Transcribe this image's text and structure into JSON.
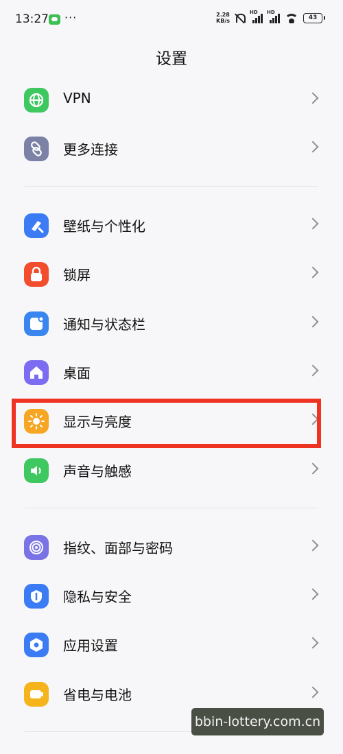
{
  "status_bar": {
    "time": "13:27",
    "net_speed_value": "2.28",
    "net_speed_unit": "KB/s",
    "sim_label": "HD",
    "battery": "43",
    "more": "···"
  },
  "page": {
    "title": "设置"
  },
  "groups": [
    [
      {
        "label": "VPN",
        "icon": "globe-icon",
        "color": "#3fc760"
      },
      {
        "label": "更多连接",
        "icon": "link-icon",
        "color": "#7b82a6"
      }
    ],
    [
      {
        "label": "壁纸与个性化",
        "icon": "brush-icon",
        "color": "#3b7cf5"
      },
      {
        "label": "锁屏",
        "icon": "lock-icon",
        "color": "#f24d2d"
      },
      {
        "label": "通知与状态栏",
        "icon": "notification-icon",
        "color": "#3a86f0"
      },
      {
        "label": "桌面",
        "icon": "home-icon",
        "color": "#7b6cf2"
      },
      {
        "label": "显示与亮度",
        "icon": "sun-icon",
        "color": "#f6a623"
      },
      {
        "label": "声音与触感",
        "icon": "speaker-icon",
        "color": "#3fc760"
      }
    ],
    [
      {
        "label": "指纹、面部与密码",
        "icon": "fingerprint-icon",
        "color": "#7a73e6"
      },
      {
        "label": "隐私与安全",
        "icon": "privacy-icon",
        "color": "#3b7cf5"
      },
      {
        "label": "应用设置",
        "icon": "app-settings-icon",
        "color": "#3b7cf5"
      },
      {
        "label": "省电与电池",
        "icon": "battery-icon",
        "color": "#f6b41c"
      }
    ]
  ],
  "highlight_color": "#ee3322",
  "watermark": "bbin-lottery.com.cn"
}
